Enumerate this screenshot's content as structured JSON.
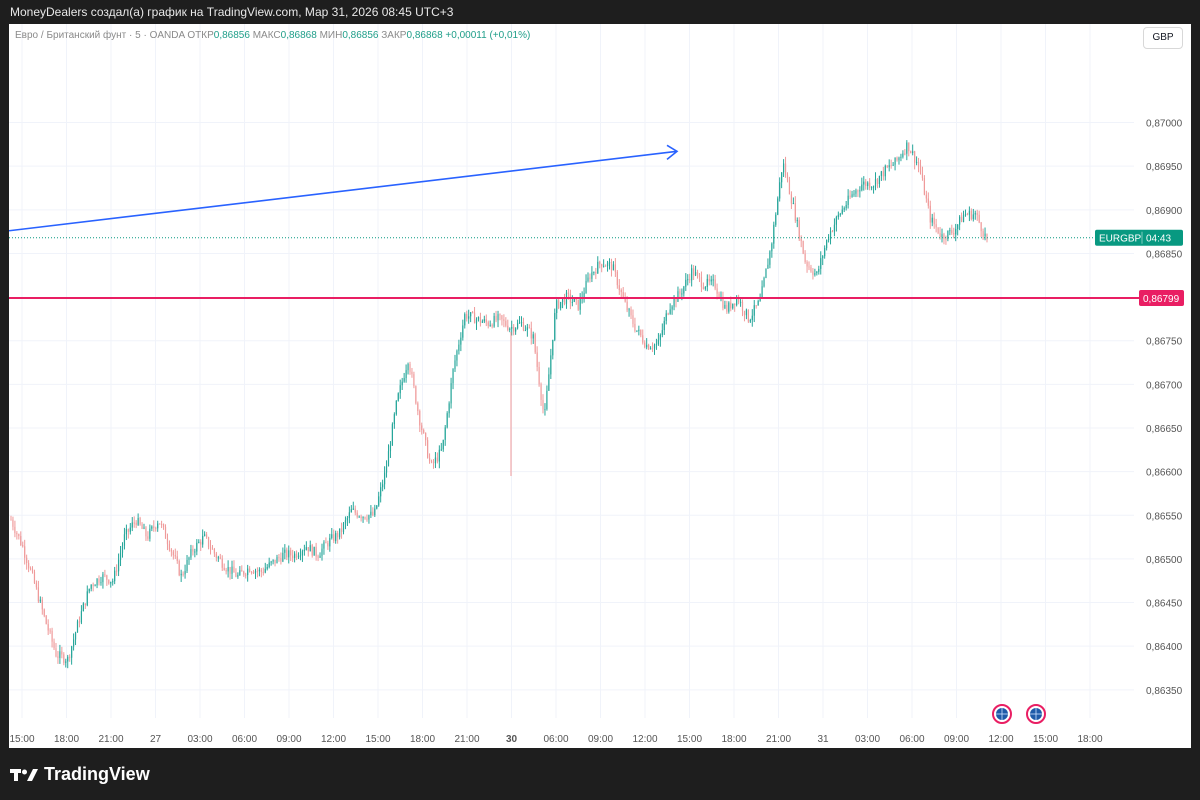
{
  "top_bar": {
    "text": "MoneyDealers создал(а) график на TradingView.com, Мар 31, 2026 08:45 UTC+3"
  },
  "header": {
    "symbol": "Евро / Британский фунт · 5 · OANDA",
    "open_label": "ОТКР",
    "open_value": "0,86856",
    "high_label": "МАКС",
    "high_value": "0,86868",
    "low_label": "МИН",
    "low_value": "0,86856",
    "close_label": "ЗАКР",
    "close_value": "0,86868",
    "change": "+0,00011 (+0,01%)"
  },
  "currency_button": "GBP",
  "footer": {
    "brand": "TradingView"
  },
  "colors": {
    "up": "#26a69a",
    "down": "#ef9a9a",
    "level": "#e91e63",
    "arrow": "#2962ff",
    "price_tag": "#089981"
  },
  "icons": [
    "event-globe-icon",
    "event-globe-icon"
  ],
  "chart_data": {
    "type": "candlestick",
    "symbol": "EURGBP",
    "timeframe": "5",
    "y_ticks": [
      "0,87000",
      "0,86950",
      "0,86900",
      "0,86850",
      "0,86750",
      "0,86700",
      "0,86650",
      "0,86600",
      "0,86550",
      "0,86500",
      "0,86450",
      "0,86400",
      "0,86350"
    ],
    "y_tick_values": [
      0.87,
      0.8695,
      0.869,
      0.8685,
      0.8675,
      0.867,
      0.8665,
      0.866,
      0.8655,
      0.865,
      0.8645,
      0.864,
      0.8635
    ],
    "ylim": [
      0.8632,
      0.8709
    ],
    "x_ticks": [
      "15:00",
      "18:00",
      "21:00",
      "27",
      "03:00",
      "06:00",
      "09:00",
      "12:00",
      "15:00",
      "18:00",
      "21:00",
      "30",
      "06:00",
      "09:00",
      "12:00",
      "15:00",
      "18:00",
      "21:00",
      "31",
      "03:00",
      "06:00",
      "09:00",
      "12:00",
      "15:00",
      "18:00"
    ],
    "x_tick_bold": [
      "30"
    ],
    "current_price_label": "EURGBP",
    "current_price_timer": "04:43",
    "current_price": 0.86868,
    "horizontal_level": {
      "label": "0,86799",
      "value": 0.86799
    },
    "trend_arrow": {
      "from_price": 0.86876,
      "to_price": 0.86967
    },
    "price_path": [
      [
        0.8655,
        0.8654
      ],
      [
        0.8652,
        0.8651
      ],
      [
        0.8649,
        0.8646
      ],
      [
        0.8644,
        0.8642
      ],
      [
        0.864,
        0.8638
      ],
      [
        0.8637,
        0.864
      ],
      [
        0.8642,
        0.8644
      ],
      [
        0.8646,
        0.8648
      ],
      [
        0.8649,
        0.8647
      ],
      [
        0.8646,
        0.8649
      ],
      [
        0.8651,
        0.8654
      ],
      [
        0.8655,
        0.8654
      ],
      [
        0.8653,
        0.8652
      ],
      [
        0.8654,
        0.8655
      ],
      [
        0.8652,
        0.8651
      ],
      [
        0.8649,
        0.8647
      ],
      [
        0.865,
        0.8652
      ],
      [
        0.8653,
        0.8652
      ],
      [
        0.8651,
        0.865
      ],
      [
        0.8649,
        0.8649
      ],
      [
        0.8648,
        0.8648
      ],
      [
        0.8649,
        0.8649
      ],
      [
        0.8648,
        0.8649
      ],
      [
        0.865,
        0.8649
      ],
      [
        0.865,
        0.8651
      ],
      [
        0.865,
        0.8651
      ],
      [
        0.8652,
        0.8651
      ],
      [
        0.865,
        0.8651
      ],
      [
        0.8652,
        0.8652
      ],
      [
        0.8651,
        0.8655
      ],
      [
        0.8656,
        0.8655
      ],
      [
        0.8654,
        0.8656
      ],
      [
        0.8656,
        0.8654
      ],
      [
        0.8658,
        0.8662
      ],
      [
        0.8666,
        0.867
      ],
      [
        0.8674,
        0.8672
      ],
      [
        0.8668,
        0.8664
      ],
      [
        0.8661,
        0.866
      ],
      [
        0.8661,
        0.8664
      ],
      [
        0.867,
        0.8674
      ],
      [
        0.8678,
        0.8678
      ],
      [
        0.8678,
        0.8677
      ],
      [
        0.8676,
        0.8678
      ],
      [
        0.8678,
        0.8677
      ],
      [
        0.8676,
        0.8677
      ],
      [
        0.8676,
        0.8678
      ],
      [
        0.8677,
        0.8674
      ],
      [
        0.8662,
        0.867
      ],
      [
        0.8676,
        0.8682
      ],
      [
        0.8681,
        0.8679
      ],
      [
        0.8678,
        0.868
      ],
      [
        0.8682,
        0.8683
      ],
      [
        0.8684,
        0.8684
      ],
      [
        0.8684,
        0.8683
      ],
      [
        0.8681,
        0.8678
      ],
      [
        0.8677,
        0.8676
      ],
      [
        0.8675,
        0.8674
      ],
      [
        0.8673,
        0.8676
      ],
      [
        0.8678,
        0.868
      ],
      [
        0.8681,
        0.868
      ],
      [
        0.8682,
        0.8684
      ],
      [
        0.8683,
        0.868
      ],
      [
        0.8682,
        0.8681
      ],
      [
        0.8679,
        0.8678
      ],
      [
        0.868,
        0.868
      ],
      [
        0.8678,
        0.8677
      ],
      [
        0.8679,
        0.868
      ],
      [
        0.8682,
        0.869
      ],
      [
        0.8696,
        0.8695
      ],
      [
        0.8692,
        0.8688
      ],
      [
        0.8686,
        0.8682
      ],
      [
        0.8681,
        0.8684
      ],
      [
        0.8686,
        0.8688
      ],
      [
        0.8689,
        0.869
      ],
      [
        0.8691,
        0.8692
      ],
      [
        0.8693,
        0.8693
      ],
      [
        0.8692,
        0.8694
      ],
      [
        0.8694,
        0.8695
      ],
      [
        0.8695,
        0.8696
      ],
      [
        0.8697,
        0.8698
      ],
      [
        0.8697,
        0.8693
      ],
      [
        0.869,
        0.8688
      ],
      [
        0.8687,
        0.8687
      ],
      [
        0.8687,
        0.8688
      ],
      [
        0.8689,
        0.869
      ],
      [
        0.869,
        0.8689
      ],
      [
        0.8687,
        0.8686
      ]
    ]
  }
}
